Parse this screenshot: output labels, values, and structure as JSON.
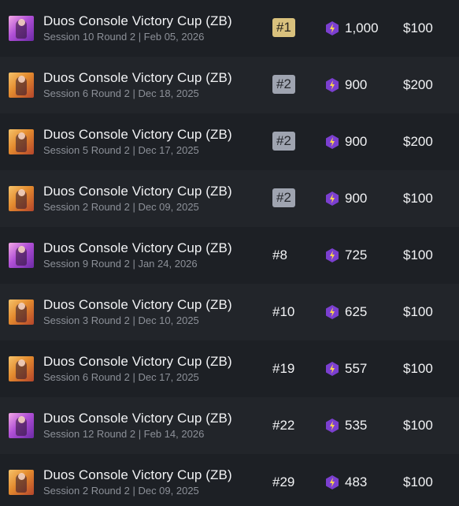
{
  "results": [
    {
      "title": "Duos Console Victory Cup (ZB)",
      "subtitle": "Session 10 Round 2 | Feb 05, 2026",
      "place": "#1",
      "place_style": "gold",
      "points": "1,000",
      "prize": "$100",
      "thumb_color": "purple",
      "thumb_icon": "fortnite-skin-thumbnail"
    },
    {
      "title": "Duos Console Victory Cup (ZB)",
      "subtitle": "Session 6 Round 2 | Dec 18, 2025",
      "place": "#2",
      "place_style": "silver",
      "points": "900",
      "prize": "$200",
      "thumb_color": "orange",
      "thumb_icon": "fortnite-skin-thumbnail"
    },
    {
      "title": "Duos Console Victory Cup (ZB)",
      "subtitle": "Session 5 Round 2 | Dec 17, 2025",
      "place": "#2",
      "place_style": "silver",
      "points": "900",
      "prize": "$200",
      "thumb_color": "orange",
      "thumb_icon": "fortnite-skin-thumbnail"
    },
    {
      "title": "Duos Console Victory Cup (ZB)",
      "subtitle": "Session 2 Round 2 | Dec 09, 2025",
      "place": "#2",
      "place_style": "silver",
      "points": "900",
      "prize": "$100",
      "thumb_color": "orange",
      "thumb_icon": "fortnite-skin-thumbnail"
    },
    {
      "title": "Duos Console Victory Cup (ZB)",
      "subtitle": "Session 9 Round 2 | Jan 24, 2026",
      "place": "#8",
      "place_style": "plain",
      "points": "725",
      "prize": "$100",
      "thumb_color": "purple",
      "thumb_icon": "fortnite-skin-thumbnail"
    },
    {
      "title": "Duos Console Victory Cup (ZB)",
      "subtitle": "Session 3 Round 2 | Dec 10, 2025",
      "place": "#10",
      "place_style": "plain",
      "points": "625",
      "prize": "$100",
      "thumb_color": "orange",
      "thumb_icon": "fortnite-skin-thumbnail"
    },
    {
      "title": "Duos Console Victory Cup (ZB)",
      "subtitle": "Session 6 Round 2 | Dec 17, 2025",
      "place": "#19",
      "place_style": "plain",
      "points": "557",
      "prize": "$100",
      "thumb_color": "orange",
      "thumb_icon": "fortnite-skin-thumbnail"
    },
    {
      "title": "Duos Console Victory Cup (ZB)",
      "subtitle": "Session 12 Round 2 | Feb 14, 2026",
      "place": "#22",
      "place_style": "plain",
      "points": "535",
      "prize": "$100",
      "thumb_color": "purple",
      "thumb_icon": "fortnite-skin-thumbnail"
    },
    {
      "title": "Duos Console Victory Cup (ZB)",
      "subtitle": "Session 2 Round 2 | Dec 09, 2025",
      "place": "#29",
      "place_style": "plain",
      "points": "483",
      "prize": "$100",
      "thumb_color": "orange",
      "thumb_icon": "fortnite-skin-thumbnail"
    }
  ],
  "colors": {
    "gold_badge": "#d9c17d",
    "silver_badge": "#9fa4b0",
    "points_icon": "#7b3fd0",
    "points_bolt": "#ffd84a",
    "row_dark": "#1d2025",
    "row_light": "#22252a"
  },
  "icons": {
    "points": "bolt-hexagon-icon"
  }
}
